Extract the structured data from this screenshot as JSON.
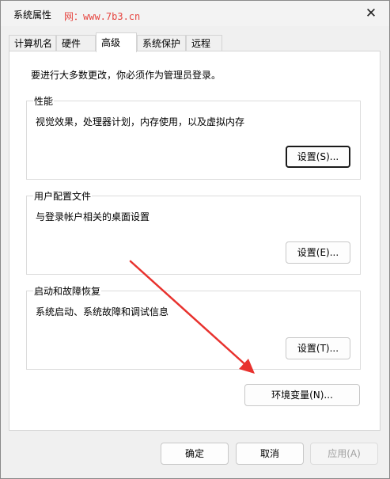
{
  "window": {
    "title": "系统属性",
    "watermark": "网：www.7b3.cn",
    "close_glyph": "✕"
  },
  "tabs": [
    {
      "label": "计算机名",
      "active": false
    },
    {
      "label": "硬件",
      "active": false
    },
    {
      "label": "高级",
      "active": true
    },
    {
      "label": "系统保护",
      "active": false
    },
    {
      "label": "远程",
      "active": false
    }
  ],
  "advanced": {
    "intro": "要进行大多数更改，你必须作为管理员登录。",
    "performance": {
      "title": "性能",
      "desc": "视觉效果，处理器计划，内存使用，以及虚拟内存",
      "button": "设置(S)..."
    },
    "profiles": {
      "title": "用户配置文件",
      "desc": "与登录帐户相关的桌面设置",
      "button": "设置(E)..."
    },
    "startup": {
      "title": "启动和故障恢复",
      "desc": "系统启动、系统故障和调试信息",
      "button": "设置(T)..."
    },
    "env_button": "环境变量(N)..."
  },
  "footer": {
    "ok": "确定",
    "cancel": "取消",
    "apply": "应用(A)"
  },
  "colors": {
    "annotation_arrow": "#e8322e",
    "window_bg": "#f0f0f0",
    "panel_bg": "#ffffff"
  }
}
